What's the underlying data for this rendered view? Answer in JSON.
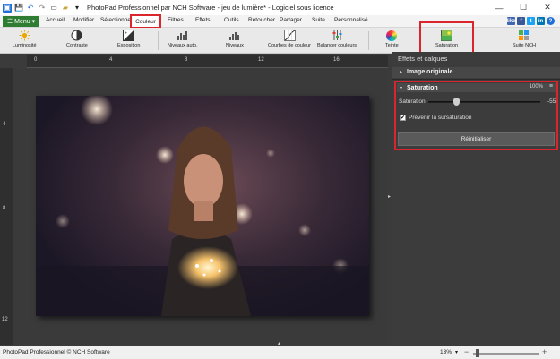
{
  "app": {
    "title": "PhotoPad Professionnel par NCH Software - jeu de lumière* - Logiciel sous licence"
  },
  "window_controls": {
    "minimize": "—",
    "maximize": "☐",
    "close": "✕"
  },
  "menubar": {
    "menu_button": "Menu",
    "tabs": [
      "Accueil",
      "Modifier",
      "Sélectionner",
      "Couleur",
      "Filtres",
      "Effets",
      "Outils",
      "Retoucher",
      "Partager",
      "Suite",
      "Personnalisé"
    ],
    "active_tab": "Couleur",
    "social": [
      "like",
      "f",
      "t",
      "in",
      "?"
    ]
  },
  "toolbar": {
    "tools": [
      "Luminosité",
      "Contraste",
      "Exposition",
      "Niveaux auto.",
      "Niveaux",
      "Courbes de couleur",
      "Balancer couleurs",
      "Teinte",
      "Saturation",
      "Suite NCH"
    ]
  },
  "ruler": {
    "h_labels": [
      "0",
      "4",
      "8",
      "12",
      "16"
    ],
    "v_labels": [
      "4",
      "8",
      "12"
    ]
  },
  "panel": {
    "title": "Effets et calques",
    "original_image": "Image originale",
    "effect_name": "Saturation",
    "opacity": "100%",
    "slider_label": "Saturation:",
    "slider_value": "-55",
    "slider_level": -55,
    "checkbox_label": "Prévenir la sursaturation",
    "checkbox_checked": true,
    "reset_button": "Réinitialiser"
  },
  "statusbar": {
    "left_text": "PhotoPad Professionnel © NCH Software",
    "zoom": "13%"
  },
  "colors": {
    "menu_green": "#2e7d32",
    "highlight_red": "#d9252b",
    "panel_bg": "#3c3c3c"
  }
}
